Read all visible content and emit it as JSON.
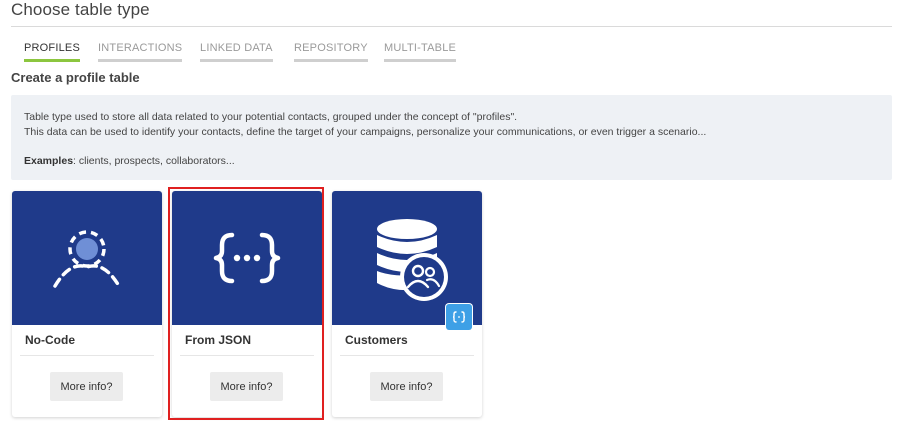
{
  "header": {
    "title": "Choose table type"
  },
  "tabs": [
    {
      "label": "PROFILES",
      "active": true
    },
    {
      "label": "INTERACTIONS",
      "active": false
    },
    {
      "label": "LINKED DATA",
      "active": false
    },
    {
      "label": "REPOSITORY",
      "active": false
    },
    {
      "label": "MULTI-TABLE",
      "active": false
    }
  ],
  "section": {
    "title": "Create a profile table",
    "description_line1": "Table type used to store all data related to your potential contacts, grouped under the concept of \"profiles\".",
    "description_line2": "This data can be used to identify your contacts, define the target of your campaigns, personalize your communications, or even trigger a scenario...",
    "examples_label": "Examples",
    "examples_text": ": clients, prospects, collaborators..."
  },
  "cards": [
    {
      "title": "No-Code",
      "button": "More info?",
      "icon": "dashed-user-icon"
    },
    {
      "title": "From JSON",
      "button": "More info?",
      "icon": "curly-braces-icon",
      "selected": true
    },
    {
      "title": "Customers",
      "button": "More info?",
      "icon": "database-users-icon",
      "badge_icon": "json-braces-icon"
    }
  ],
  "colors": {
    "card_cover": "#1f3a8a",
    "active_tab": "#8cc63f",
    "highlight": "#e02020",
    "badge": "#3ea0e6"
  }
}
